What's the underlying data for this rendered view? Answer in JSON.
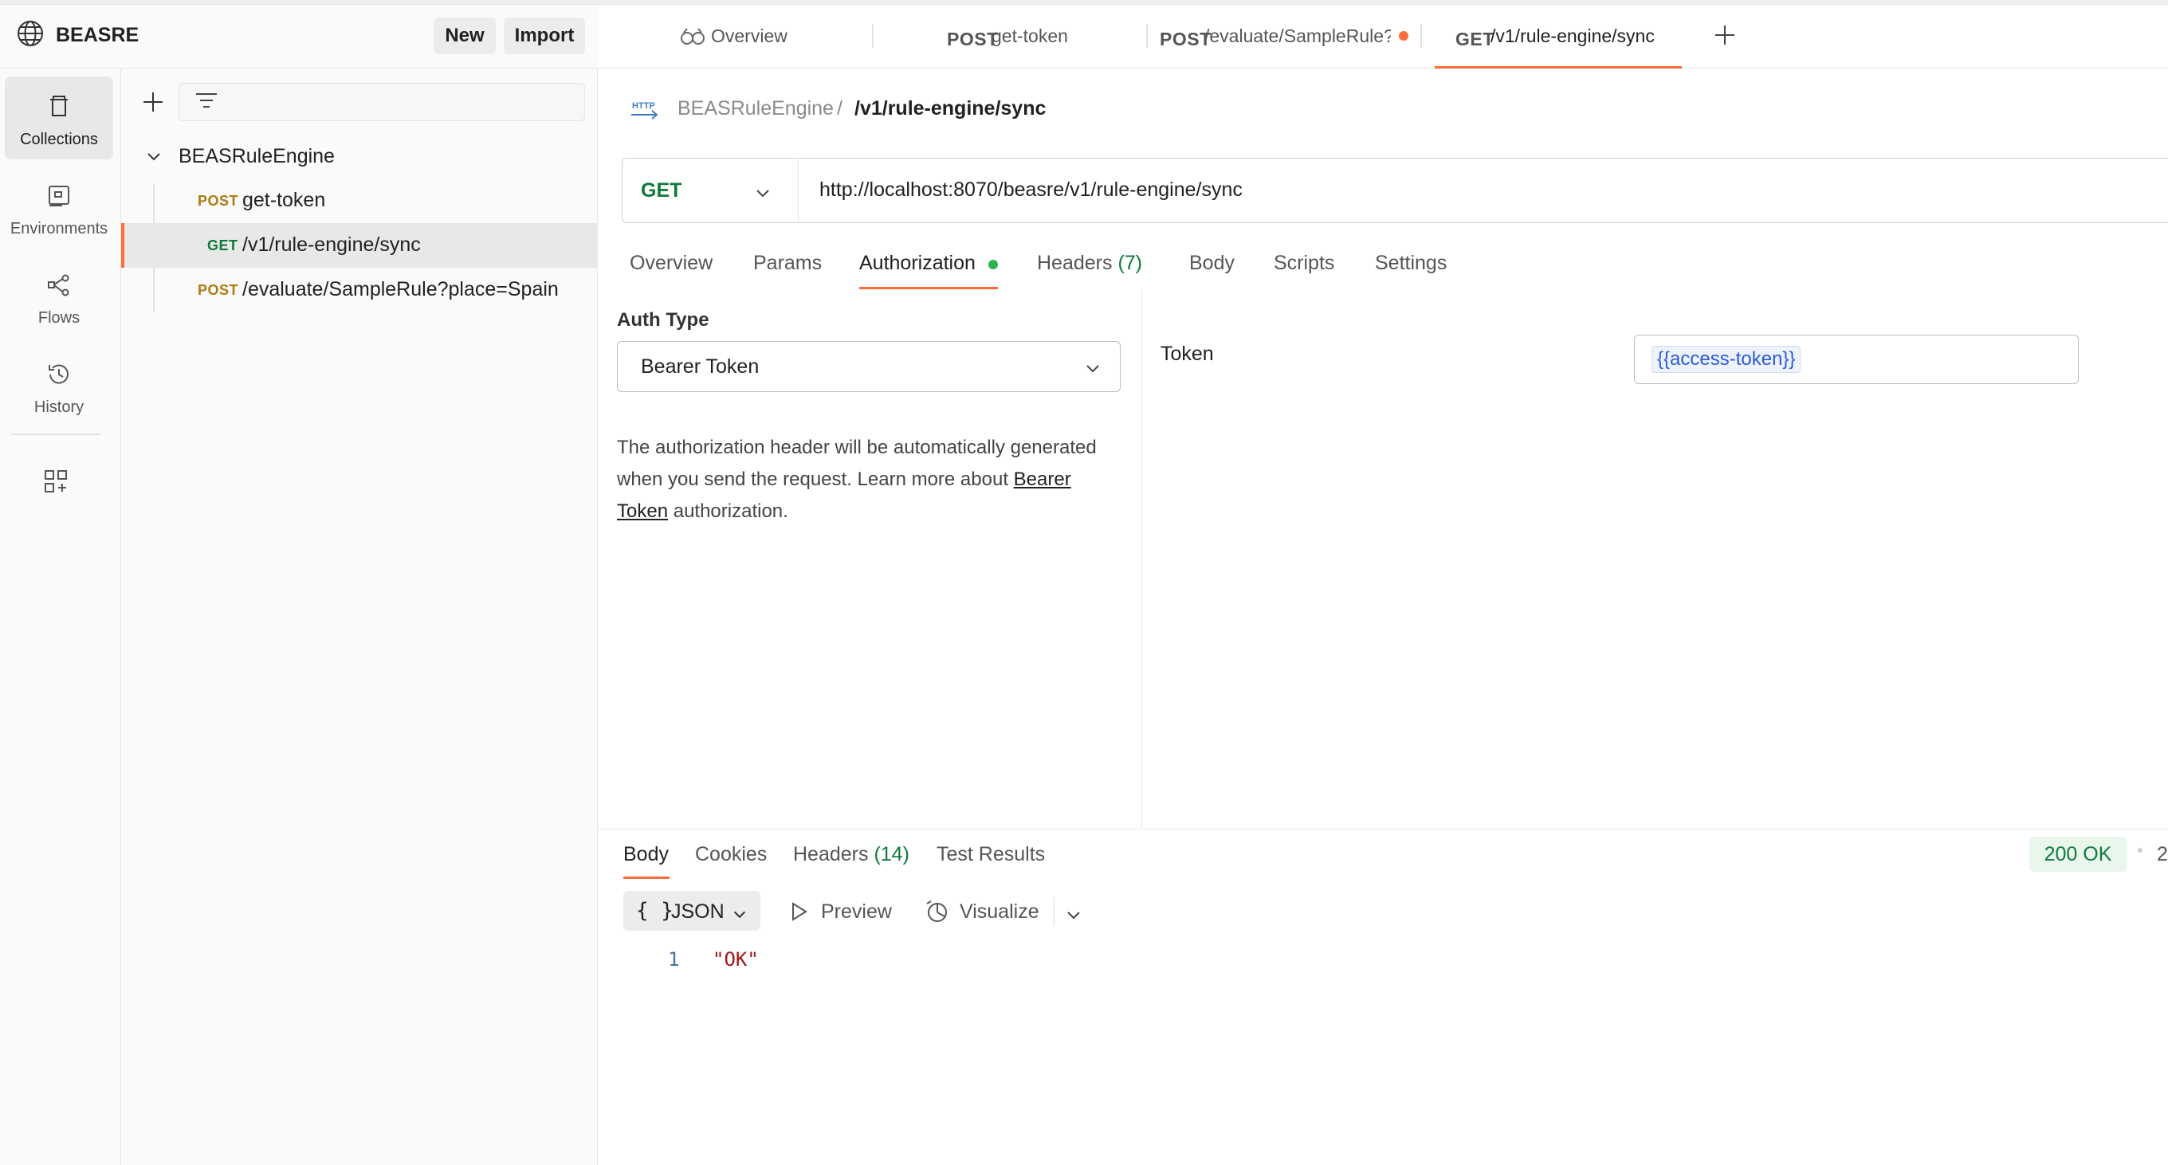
{
  "workspace": {
    "name": "BEASRE",
    "new_label": "New",
    "import_label": "Import"
  },
  "sidebar": {
    "items": [
      {
        "label": "Collections",
        "icon": "trash-can-icon"
      },
      {
        "label": "Environments",
        "icon": "environment-icon"
      },
      {
        "label": "Flows",
        "icon": "flows-icon"
      },
      {
        "label": "History",
        "icon": "history-icon"
      }
    ]
  },
  "tree": {
    "collection": "BEASRuleEngine",
    "requests": [
      {
        "method": "POST",
        "path": "get-token"
      },
      {
        "method": "GET",
        "path": "/v1/rule-engine/sync"
      },
      {
        "method": "POST",
        "path": "/evaluate/SampleRule?place=Spain"
      }
    ]
  },
  "tabs": [
    {
      "label": "Overview"
    },
    {
      "method": "POST",
      "label": "get-token"
    },
    {
      "method": "POST",
      "label": "/evaluate/SampleRule?"
    },
    {
      "method": "GET",
      "label": "/v1/rule-engine/sync"
    }
  ],
  "breadcrumb": {
    "icon_text": "HTTP",
    "collection": "BEASRuleEngine",
    "separator": "/",
    "request": "/v1/rule-engine/sync"
  },
  "request": {
    "method": "GET",
    "url": "http://localhost:8070/beasre/v1/rule-engine/sync",
    "tabs": {
      "overview": "Overview",
      "params": "Params",
      "authorization": "Authorization",
      "headers": "Headers",
      "headers_count": "(7)",
      "body": "Body",
      "scripts": "Scripts",
      "settings": "Settings"
    }
  },
  "auth": {
    "type_label": "Auth Type",
    "type_value": "Bearer Token",
    "desc_prefix": "The authorization header will be automatically generated when you send the request. Learn more about ",
    "desc_link": "Bearer Token",
    "desc_suffix": " authorization.",
    "token_label": "Token",
    "token_value": "{{access-token}}"
  },
  "response": {
    "tabs": {
      "body": "Body",
      "cookies": "Cookies",
      "headers": "Headers",
      "headers_count": "(14)",
      "test_results": "Test Results"
    },
    "status": "200 OK",
    "status_more": "2",
    "format": "JSON",
    "preview": "Preview",
    "visualize": "Visualize",
    "line_number": "1",
    "line_value": "\"OK\""
  },
  "colors": {
    "accent": "#ff6c37",
    "get": "#0d7a3a",
    "post": "#b07a10"
  }
}
